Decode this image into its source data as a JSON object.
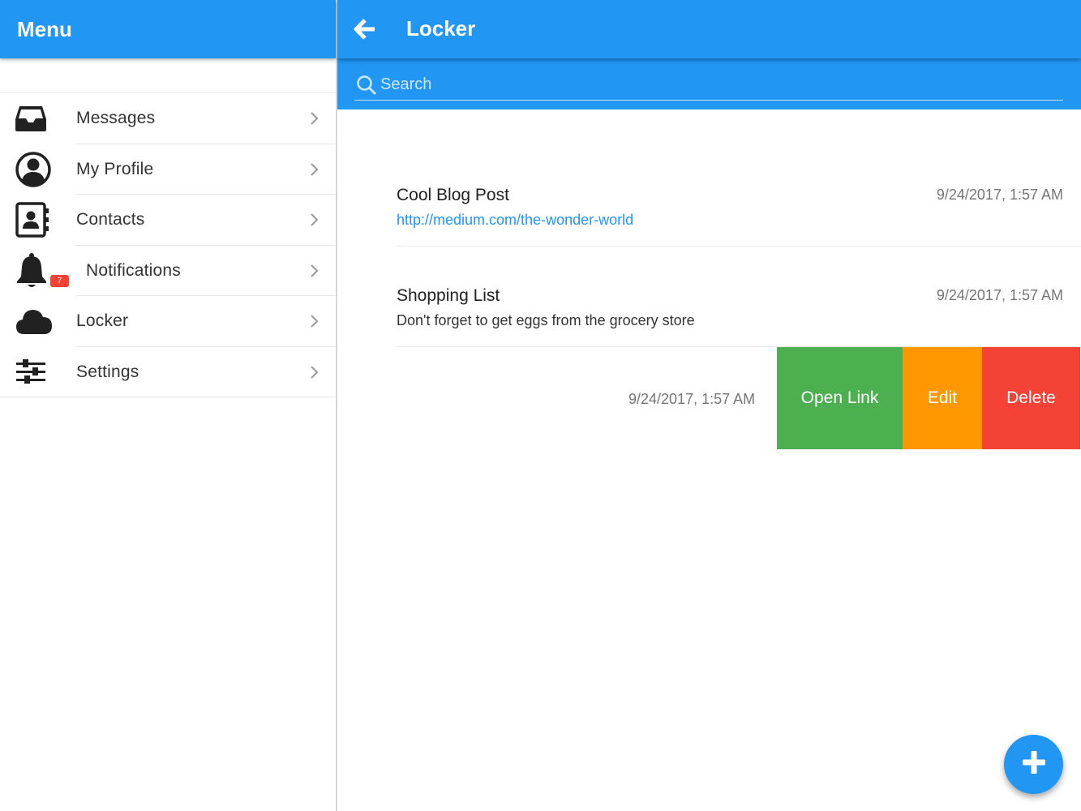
{
  "sidebar": {
    "title": "Menu",
    "items": [
      {
        "label": "Messages",
        "icon": "inbox-icon"
      },
      {
        "label": "My Profile",
        "icon": "user-circle-icon"
      },
      {
        "label": "Contacts",
        "icon": "address-book-icon"
      },
      {
        "label": "Notifications",
        "icon": "bell-icon",
        "badge": "7"
      },
      {
        "label": "Locker",
        "icon": "cloud-icon"
      },
      {
        "label": "Settings",
        "icon": "sliders-icon"
      }
    ]
  },
  "header": {
    "title": "Locker",
    "back_icon": "arrow-left-icon"
  },
  "search": {
    "placeholder": "Search",
    "value": ""
  },
  "items": [
    {
      "title": "Cool Blog Post",
      "subtitle": "http://medium.com/the-wonder-world",
      "date": "9/24/2017, 1:57 AM",
      "is_link": true
    },
    {
      "title": "Shopping List",
      "subtitle": "Don't forget to get eggs from the grocery store",
      "date": "9/24/2017, 1:57 AM",
      "is_link": false
    }
  ],
  "swiped_item": {
    "date": "9/24/2017, 1:57 AM",
    "actions": {
      "open_link": "Open Link",
      "edit": "Edit",
      "delete": "Delete"
    }
  },
  "fab": {
    "icon": "plus-icon"
  },
  "colors": {
    "primary": "#2196f3",
    "open_link": "#4caf50",
    "edit": "#ff9800",
    "delete": "#f44336",
    "badge": "#f44336"
  }
}
